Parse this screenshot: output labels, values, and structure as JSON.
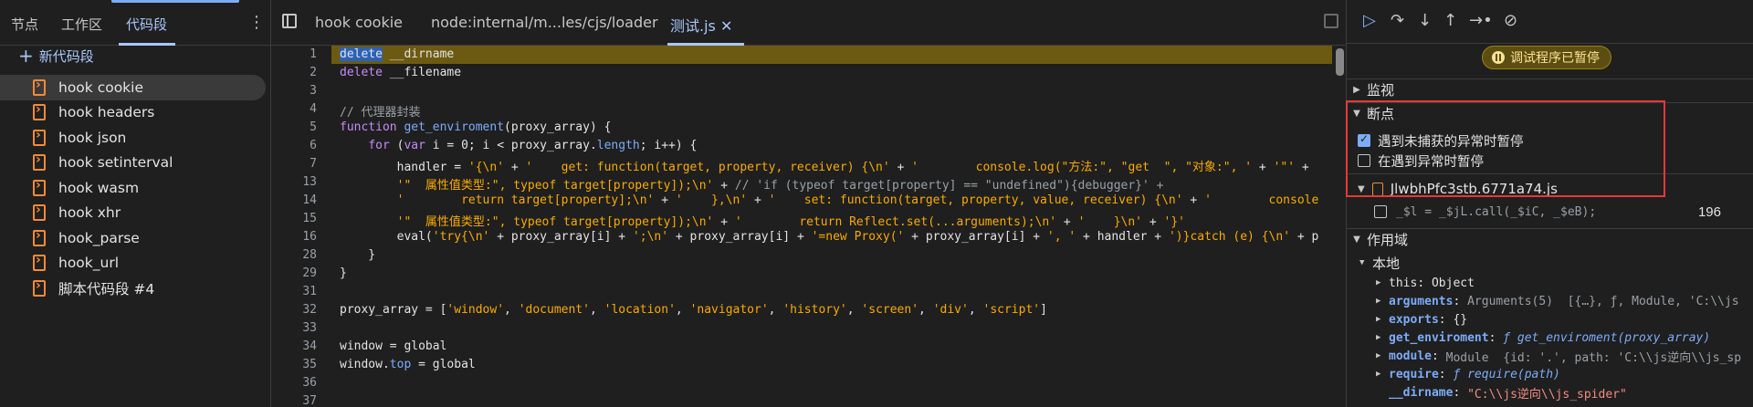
{
  "sources_sidebar": {
    "tabs": [
      {
        "label": "节点"
      },
      {
        "label": "工作区"
      },
      {
        "label": "代码段"
      }
    ],
    "new_snippet": "新代码段",
    "snippets": [
      {
        "label": "hook cookie"
      },
      {
        "label": "hook headers"
      },
      {
        "label": "hook json"
      },
      {
        "label": "hook setinterval"
      },
      {
        "label": "hook wasm"
      },
      {
        "label": "hook xhr"
      },
      {
        "label": "hook_parse"
      },
      {
        "label": "hook_url"
      },
      {
        "label": "脚本代码段 #4"
      }
    ],
    "selected_index": 0
  },
  "editor": {
    "tabs": [
      {
        "label": "hook cookie"
      },
      {
        "label": "node:internal/m...les/cjs/loader"
      },
      {
        "label": "测试.js"
      }
    ],
    "active_tab": 2,
    "line_numbers": [
      "1",
      "2",
      "3",
      "4",
      "5",
      "6",
      "7",
      "13",
      "14",
      "15",
      "16",
      "28",
      "29",
      "31",
      "32",
      "33",
      "34",
      "35",
      "36",
      "37"
    ],
    "paused_line": "1"
  },
  "debugger": {
    "toolbar_icons": [
      "resume-icon",
      "step-over-icon",
      "step-into-icon",
      "step-out-icon",
      "step-icon",
      "deactivate-breakpoints-icon"
    ],
    "paused_badge": "调试程序已暂停",
    "watch_section": "监视",
    "breakpoints_section": "断点",
    "pause_uncaught_label": "遇到未捕获的异常时暂停",
    "pause_uncaught_checked": true,
    "pause_caught_label": "在遇到异常时暂停",
    "pause_caught_checked": false,
    "breakpoint_file": "JlwbhPfc3stb.6771a74.js",
    "breakpoint_code": "_$l = _$jL.call(_$iC, _$eB);",
    "breakpoint_line": "196",
    "scope_section": "作用域",
    "local_label": "本地",
    "scope_items": [
      {
        "key": "this",
        "value": "Object"
      },
      {
        "key": "arguments",
        "value": "Arguments(5)  [{…}, ƒ, Module, 'C:\\\\js"
      },
      {
        "key": "exports",
        "value": "{}"
      },
      {
        "key": "get_enviroment",
        "value": "ƒ get_enviroment(proxy_array)"
      },
      {
        "key": "module",
        "value": "Module  {id: '.', path: 'C:\\\\js逆向\\\\js_sp"
      },
      {
        "key": "require",
        "value": "ƒ require(path)"
      },
      {
        "key": "__dirname",
        "value": "\"C:\\\\js逆向\\\\js_spider\""
      }
    ]
  },
  "colors": {
    "accent": "#a8c7fa",
    "paused_highlight": "#6d5a12",
    "snippet_icon": "#f28b39",
    "highlight_box": "#e53935"
  }
}
